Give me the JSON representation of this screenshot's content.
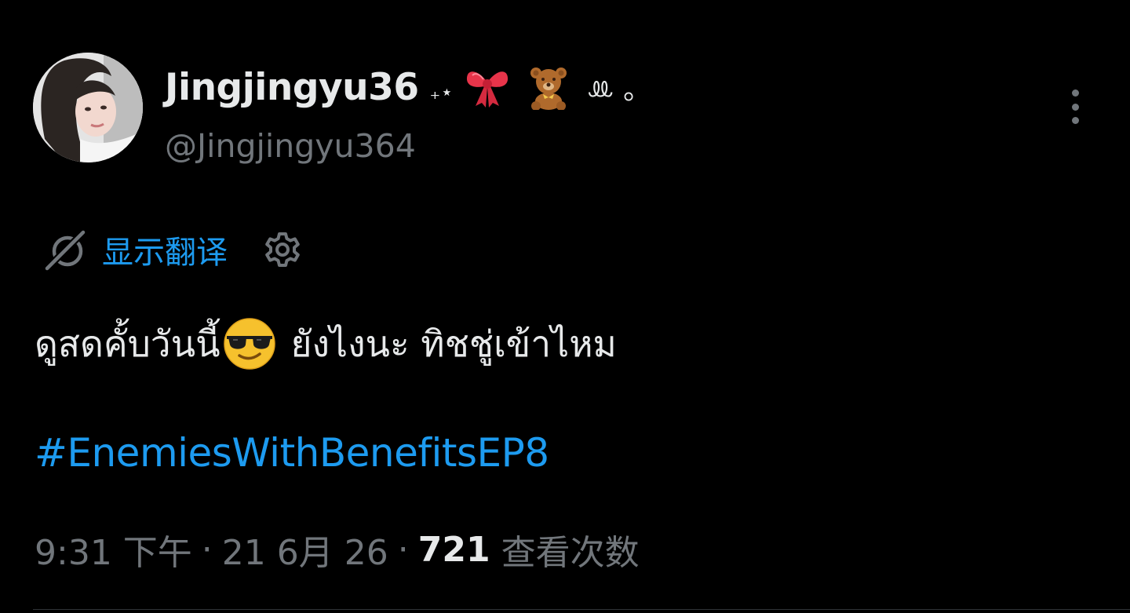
{
  "author": {
    "display_name": "Jingjingyu36",
    "name_decoration_sparkle": "₊⋆",
    "name_decoration_emojis": [
      "ribbon",
      "teddy-bear"
    ],
    "name_decoration_text": "ꔛ ｡",
    "handle": "@Jingjingyu364",
    "avatar": "profile-photo"
  },
  "translate": {
    "link_label": "显示翻译"
  },
  "tweet": {
    "text_before_emoji": "ดูสดคั้บวันนี้",
    "emoji": "smiling-face-with-sunglasses",
    "text_after_emoji": "ยังไงนะ ทิชชู่เข้าไหม",
    "hashtag": "#EnemiesWithBenefitsEP8"
  },
  "meta": {
    "time": "9:31 下午",
    "separator": "·",
    "date": "21 6月 26",
    "views_count": "721",
    "views_label": "查看次数"
  },
  "colors": {
    "background": "#000000",
    "primary_text": "#e7e9ea",
    "secondary_text": "#71767b",
    "accent": "#1d9bf0",
    "divider": "#2f3336"
  }
}
